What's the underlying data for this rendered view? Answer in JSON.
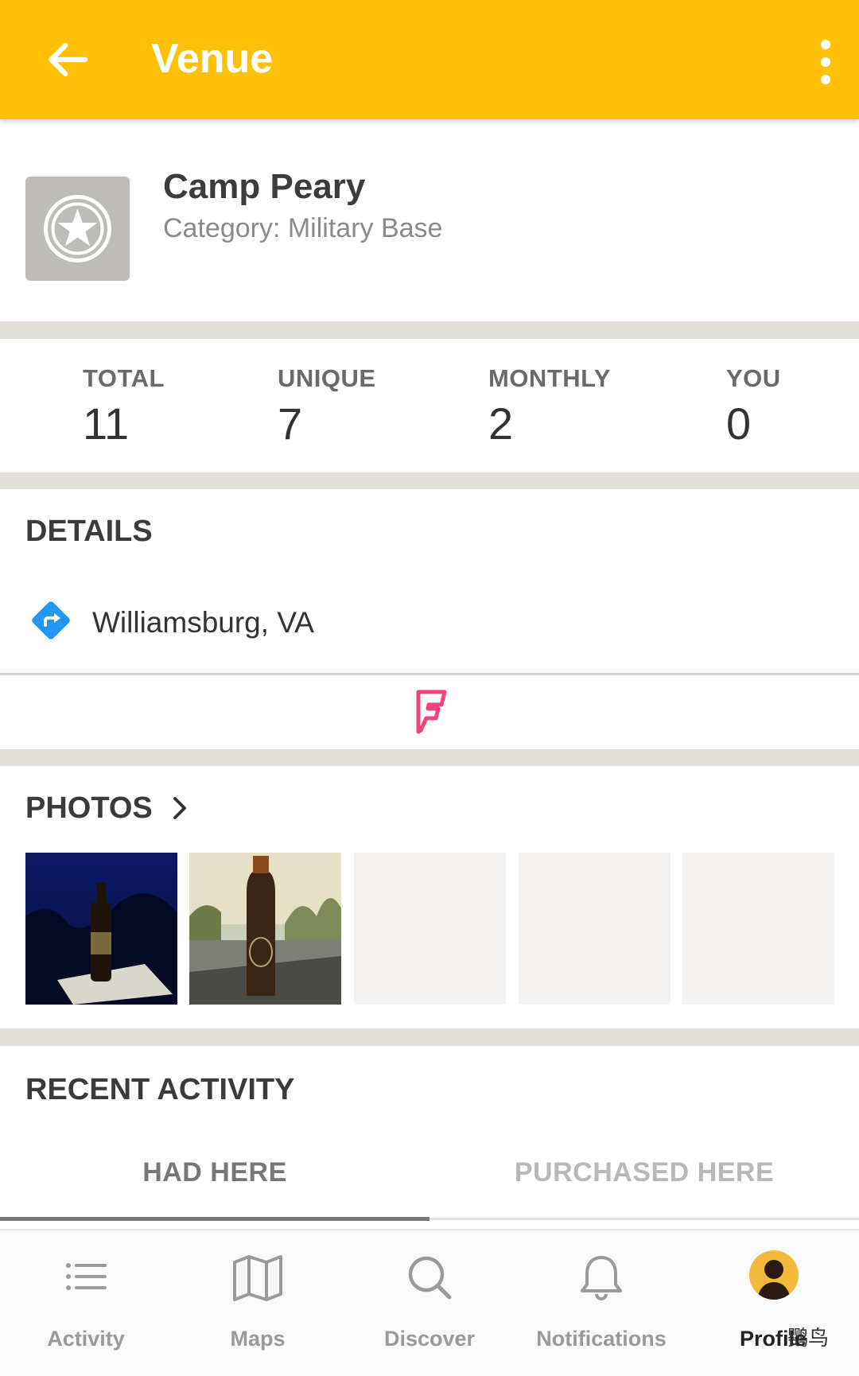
{
  "header": {
    "title": "Venue",
    "back_icon": "arrow-left-icon",
    "menu_icon": "more-vert-icon",
    "accent": "#FFC107"
  },
  "venue": {
    "name": "Camp Peary",
    "category": "Category: Military Base",
    "icon": "star-badge-icon"
  },
  "stats": [
    {
      "label": "TOTAL",
      "value": "11"
    },
    {
      "label": "UNIQUE",
      "value": "7"
    },
    {
      "label": "MONTHLY",
      "value": "2"
    },
    {
      "label": "YOU",
      "value": "0"
    }
  ],
  "details": {
    "title": "DETAILS",
    "location": "Williamsburg, VA",
    "directions_icon": "directions-icon",
    "foursquare_icon": "foursquare-icon"
  },
  "photos": {
    "title": "PHOTOS",
    "count_loaded": 2,
    "count_placeholders": 3
  },
  "recent": {
    "title": "RECENT ACTIVITY",
    "tabs": [
      "HAD HERE",
      "PURCHASED HERE"
    ],
    "active_tab": "HAD HERE"
  },
  "nav": [
    {
      "label": "Activity",
      "icon": "list-icon"
    },
    {
      "label": "Maps",
      "icon": "map-icon"
    },
    {
      "label": "Discover",
      "icon": "search-icon"
    },
    {
      "label": "Notifications",
      "icon": "bell-icon"
    },
    {
      "label": "Profile",
      "icon": "avatar",
      "active": true
    }
  ],
  "watermark": "鹦鸟"
}
